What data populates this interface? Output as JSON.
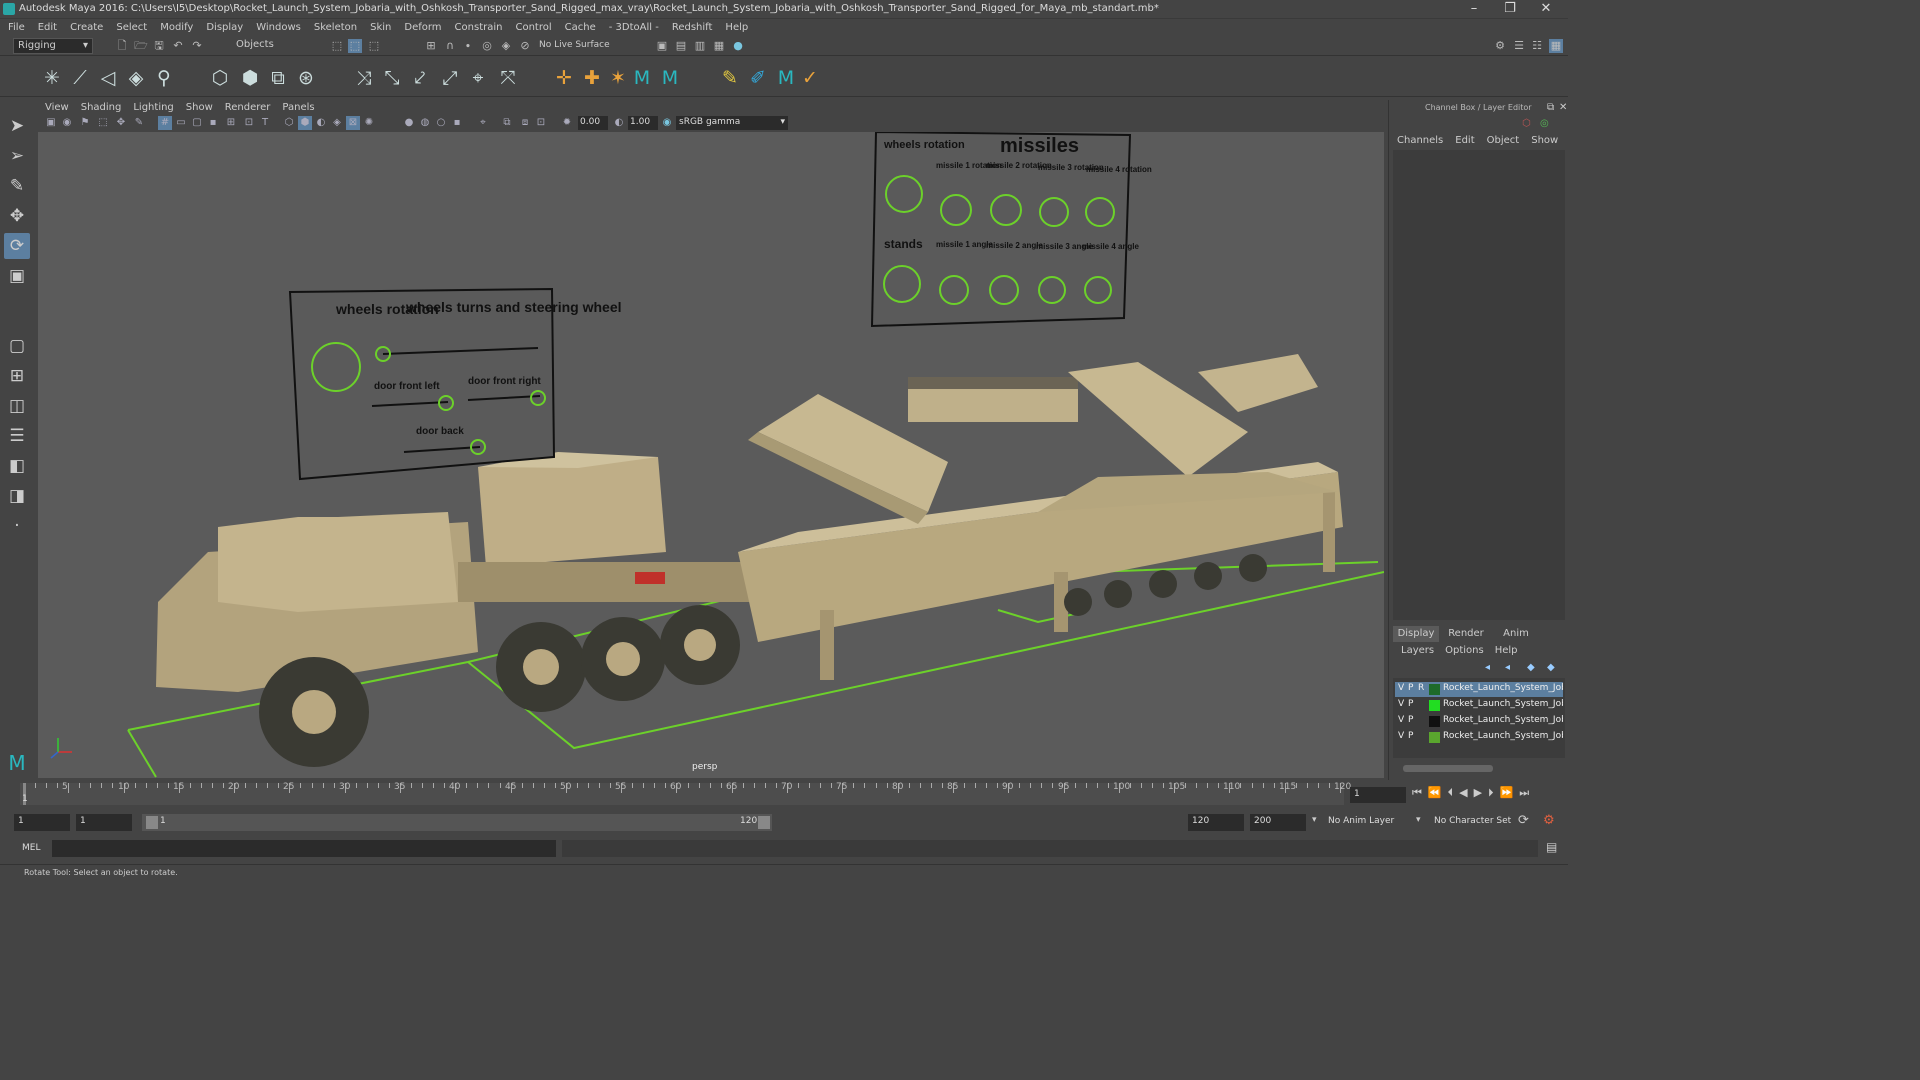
{
  "title_bar": {
    "title": "Autodesk Maya 2016: C:\\Users\\I5\\Desktop\\Rocket_Launch_System_Jobaria_with_Oshkosh_Transporter_Sand_Rigged_max_vray\\Rocket_Launch_System_Jobaria_with_Oshkosh_Transporter_Sand_Rigged_for_Maya_mb_standart.mb*",
    "minimize": "–",
    "restore": "❐",
    "close": "✕"
  },
  "menubar": [
    "File",
    "Edit",
    "Create",
    "Select",
    "Modify",
    "Display",
    "Windows",
    "Skeleton",
    "Skin",
    "Deform",
    "Constrain",
    "Control",
    "Cache",
    "- 3DtoAll -",
    "Redshift",
    "Help"
  ],
  "status_line": {
    "mode_dropdown": "Rigging",
    "selection_mode": "Objects",
    "live_surface": "No Live Surface"
  },
  "panel_menu": [
    "View",
    "Shading",
    "Lighting",
    "Show",
    "Renderer",
    "Panels"
  ],
  "panel_toolbar": {
    "gamma_value": "0.00",
    "exposure_value": "1.00",
    "color_space": "sRGB gamma"
  },
  "viewport": {
    "camera_label": "persp",
    "panel1": {
      "title_left": "wheels rotation",
      "title_right": "wheels turns and steering wheel",
      "door_front_left": "door front left",
      "door_front_right": "door front right",
      "door_back": "door back"
    },
    "panel2": {
      "wheels_rotation": "wheels rotation",
      "missiles": "missiles",
      "missile_labels": [
        "missile 1 rotation",
        "missile 2 rotation",
        "missile 3 rotation",
        "missile 4 rotation"
      ],
      "stands": "stands",
      "angle_labels": [
        "missile 1 angle",
        "missile 2 angle",
        "missile 3 angle",
        "missile 4 angle"
      ]
    }
  },
  "channel_box": {
    "title": "Channel Box / Layer Editor",
    "menu": [
      "Channels",
      "Edit",
      "Object",
      "Show"
    ],
    "layer_tabs": [
      "Display",
      "Render",
      "Anim"
    ],
    "layer_menu": [
      "Layers",
      "Options",
      "Help"
    ],
    "layers": [
      {
        "v": "V",
        "p": "P",
        "r": "R",
        "color": "#1e6a2a",
        "name": "Rocket_Launch_System_Jobaria",
        "selected": true
      },
      {
        "v": "V",
        "p": "P",
        "r": "",
        "color": "#22dd22",
        "name": "Rocket_Launch_System_Jobaria",
        "selected": false
      },
      {
        "v": "V",
        "p": "P",
        "r": "",
        "color": "#111111",
        "name": "Rocket_Launch_System_Jobaria",
        "selected": false
      },
      {
        "v": "V",
        "p": "P",
        "r": "",
        "color": "#5aa62e",
        "name": "Rocket_Launch_System_Jobaria",
        "selected": false
      }
    ]
  },
  "timeline": {
    "ticks": [
      "5",
      "10",
      "15",
      "20",
      "25",
      "30",
      "35",
      "40",
      "45",
      "50",
      "55",
      "60",
      "65",
      "70",
      "75",
      "80",
      "85",
      "90",
      "95",
      "100",
      "105",
      "110",
      "115",
      "120"
    ],
    "start_label": "1",
    "current_frame": "1"
  },
  "range": {
    "start": "1",
    "playback_start": "1",
    "slider_start": "1",
    "slider_end": "120",
    "playback_end": "120",
    "end": "200",
    "anim_layer": "No Anim Layer",
    "character_set": "No Character Set"
  },
  "command_line": {
    "label": "MEL"
  },
  "help_line": {
    "text": "Rotate Tool: Select an object to rotate."
  }
}
